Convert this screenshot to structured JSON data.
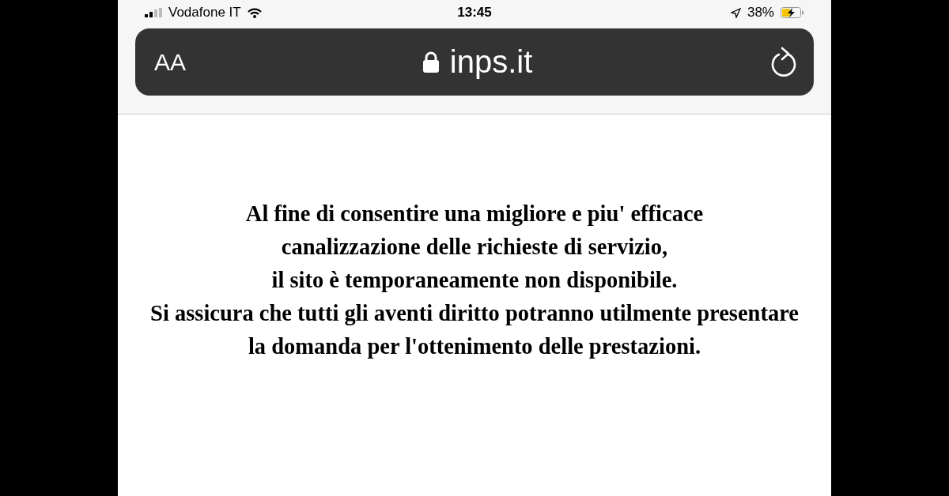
{
  "status_bar": {
    "carrier": "Vodafone IT",
    "time": "13:45",
    "battery": "38%"
  },
  "address_bar": {
    "text_size_button": "AA",
    "url": "inps.it"
  },
  "page": {
    "message_lines": [
      "Al fine di consentire una migliore e piu' efficace",
      "canalizzazione delle richieste di servizio,",
      "il sito è temporaneamente non disponibile.",
      "Si assicura che tutti gli aventi diritto potranno utilmente presentare",
      "la domanda per l'ottenimento delle prestazioni."
    ]
  }
}
